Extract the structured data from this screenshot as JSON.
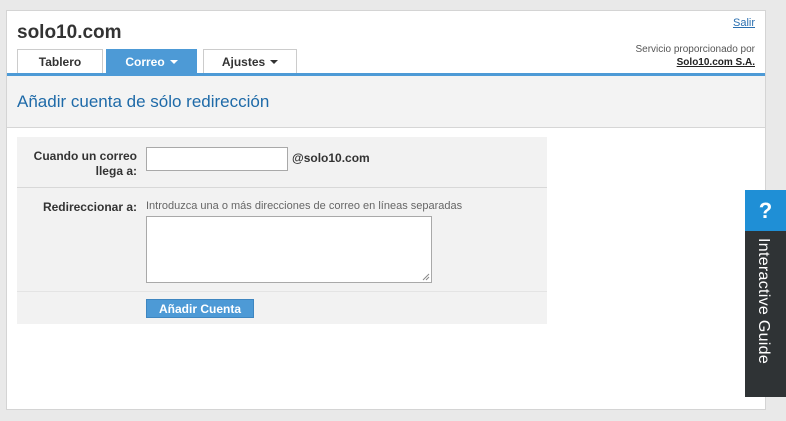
{
  "header": {
    "site_title": "solo10.com",
    "logout_label": "Salir",
    "provider_text": "Servicio proporcionado por",
    "provider_company": "Solo10.com S.A."
  },
  "tabs": [
    {
      "label": "Tablero",
      "active": false,
      "dropdown": false
    },
    {
      "label": "Correo",
      "active": true,
      "dropdown": true
    },
    {
      "label": "Ajustes",
      "active": false,
      "dropdown": true
    }
  ],
  "page": {
    "heading": "Añadir cuenta de sólo redirección"
  },
  "form": {
    "when_label_line1": "Cuando un correo",
    "when_label_line2": "llega a:",
    "address_value": "",
    "domain_suffix": "@solo10.com",
    "redirect_label": "Redireccionar a:",
    "redirect_hint": "Introduzca una o más direcciones de correo en líneas separadas",
    "redirect_value": "",
    "submit_label": "Añadir Cuenta"
  },
  "guide": {
    "icon": "question-mark-icon",
    "icon_glyph": "?",
    "label": "Interactive Guide"
  },
  "colors": {
    "accent": "#4d9ad6",
    "heading": "#1e6aa8",
    "guide_bg": "#2f3335",
    "guide_icon_bg": "#1f8fd6"
  }
}
